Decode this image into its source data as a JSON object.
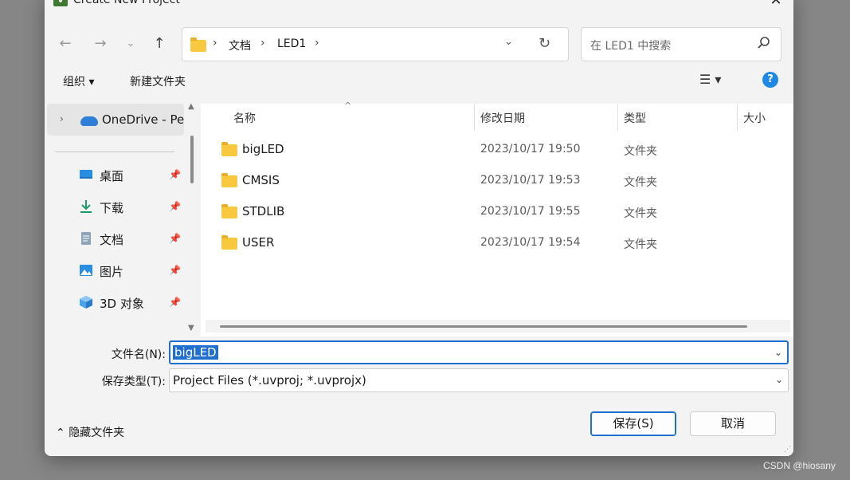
{
  "window": {
    "title": "Create New Project"
  },
  "address": {
    "crumbs": [
      "文档",
      "LED1"
    ]
  },
  "search": {
    "placeholder": "在 LED1 中搜索"
  },
  "toolbar": {
    "organize": "组织 ▾",
    "new_folder": "新建文件夹"
  },
  "nav": {
    "onedrive": "OneDrive - Per",
    "items": [
      {
        "label": "桌面",
        "icon": "desktop-icon"
      },
      {
        "label": "下载",
        "icon": "download-icon"
      },
      {
        "label": "文档",
        "icon": "documents-icon"
      },
      {
        "label": "图片",
        "icon": "pictures-icon"
      },
      {
        "label": "3D 对象",
        "icon": "3d-objects-icon"
      }
    ]
  },
  "columns": {
    "name": "名称",
    "date": "修改日期",
    "type": "类型",
    "size": "大小"
  },
  "files": [
    {
      "name": "bigLED",
      "date": "2023/10/17 19:50",
      "type": "文件夹"
    },
    {
      "name": "CMSIS",
      "date": "2023/10/17 19:53",
      "type": "文件夹"
    },
    {
      "name": "STDLIB",
      "date": "2023/10/17 19:55",
      "type": "文件夹"
    },
    {
      "name": "USER",
      "date": "2023/10/17 19:54",
      "type": "文件夹"
    }
  ],
  "form": {
    "filename_label": "文件名(N):",
    "filename_value": "bigLED",
    "filetype_label": "保存类型(T):",
    "filetype_value": "Project Files (*.uvproj; *.uvprojx)"
  },
  "buttons": {
    "hide_folders": "隐藏文件夹",
    "save": "保存(S)",
    "cancel": "取消"
  },
  "watermark": "CSDN @hiosany",
  "colors": {
    "accent": "#1e6fd0",
    "folder": "#f8c93e"
  }
}
